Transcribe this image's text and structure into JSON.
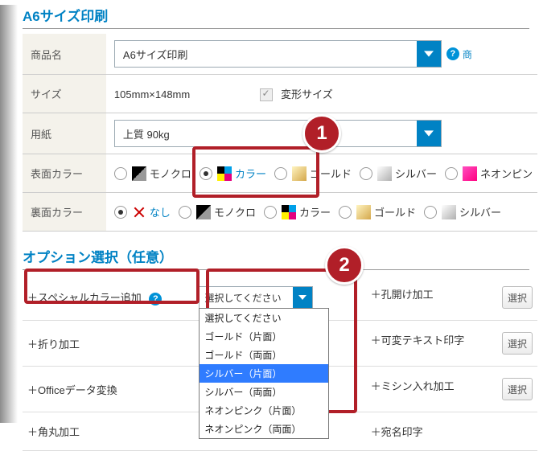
{
  "title_main": "A6サイズ印刷",
  "title_options": "オプション選択（任意）",
  "rows": {
    "product_label": "商品名",
    "product_value": "A6サイズ印刷",
    "product_help": "商",
    "size_label": "サイズ",
    "size_value": "105mm×148mm",
    "size_variant": "変形サイズ",
    "paper_label": "用紙",
    "paper_value": "上質 90kg",
    "front_label": "表面カラー",
    "back_label": "裏面カラー"
  },
  "colors": {
    "mono": "モノクロ",
    "color": "カラー",
    "gold": "ゴールド",
    "silver": "シルバー",
    "neon": "ネオンピン",
    "none": "なし"
  },
  "options": {
    "special_color": "＋スペシャルカラー追加",
    "hole": "＋孔開け加工",
    "fold": "＋折り加工",
    "variable_text": "＋可変テキスト印字",
    "office": "＋Officeデータ変換",
    "sewing": "＋ミシン入れ加工",
    "round": "＋角丸加工",
    "addr": "＋宛名印字",
    "btn_select": "選択"
  },
  "dropdown": {
    "current": "選択してください",
    "items": [
      "選択してください",
      "ゴールド（片面）",
      "ゴールド（両面）",
      "シルバー（片面）",
      "シルバー（両面）",
      "ネオンピンク（片面）",
      "ネオンピンク（両面）"
    ],
    "highlight_index": 3
  },
  "help_q": "?"
}
